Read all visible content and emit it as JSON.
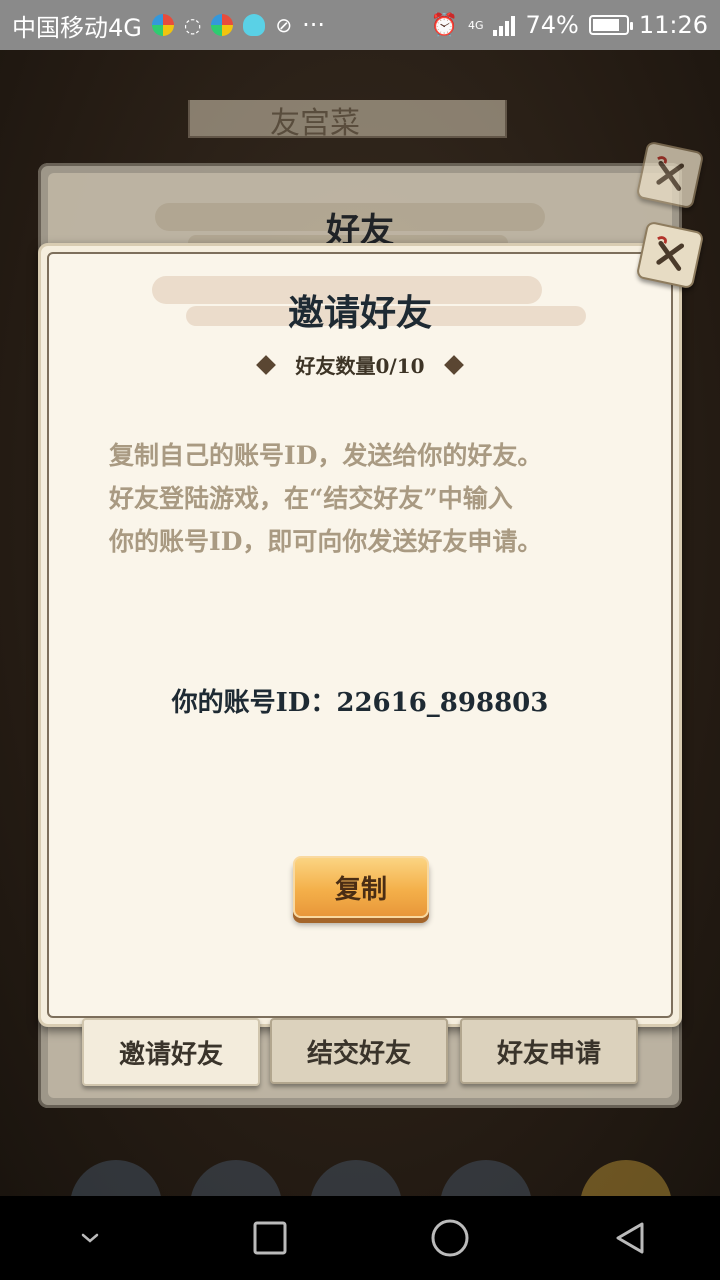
{
  "status_bar": {
    "carrier": "中国移动4G",
    "network": "4G",
    "battery": "74%",
    "time": "11:26"
  },
  "background_title": "友宫菜",
  "back_panel": {
    "title": "好友"
  },
  "dialog": {
    "title": "邀请好友",
    "friend_count": "好友数量0/10",
    "description_lines": [
      "复制自己的账号ID，发送给你的好友。",
      "好友登陆游戏，在“结交好友”中输入",
      "你的账号ID，即可向你发送好友申请。"
    ],
    "account_id_text": "你的账号ID：22616_898803",
    "copy_label": "复制"
  },
  "tabs": [
    {
      "label": "邀请好友",
      "active": true
    },
    {
      "label": "结交好友",
      "active": false
    },
    {
      "label": "好友申请",
      "active": false
    }
  ],
  "colors": {
    "title_dark": "#1e2a33",
    "desc_text": "#a99a82",
    "copy_button": "#f4b04a"
  },
  "icons": {
    "close": "close-x-icon",
    "nav_back": "back-triangle-icon",
    "nav_home": "home-circle-icon",
    "nav_recent": "recent-square-icon",
    "nav_down": "chevron-down-icon"
  }
}
